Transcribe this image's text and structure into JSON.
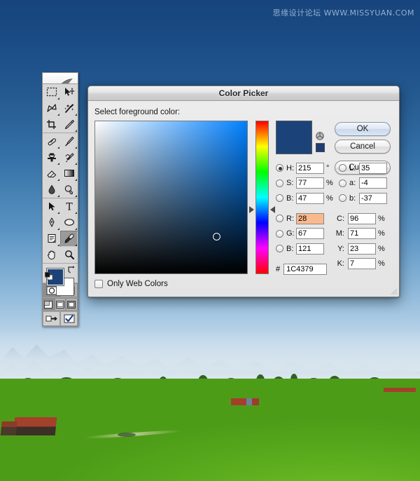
{
  "desktop": {
    "watermark": "思缘设计论坛  WWW.MISSYUAN.COM",
    "wallpaper_name": "alpine-meadow-wallpaper",
    "sky_top_color": "#17447c",
    "sky_horizon_color": "#cfdfeb",
    "meadow_color": "#66b427"
  },
  "toolbar": {
    "name": "Photoshop Tools",
    "logo": "feather-logo",
    "tools": [
      {
        "name": "marquee-tool",
        "icon": "marquee-icon",
        "selected": false
      },
      {
        "name": "move-tool",
        "icon": "move-icon",
        "selected": false
      },
      {
        "name": "lasso-tool",
        "icon": "lasso-icon",
        "selected": false
      },
      {
        "name": "magic-wand-tool",
        "icon": "magic-wand-icon",
        "selected": false
      },
      {
        "name": "crop-tool",
        "icon": "crop-icon",
        "selected": false
      },
      {
        "name": "slice-tool",
        "icon": "slice-icon",
        "selected": false
      },
      {
        "name": "healing-brush-tool",
        "icon": "healing-brush-icon",
        "selected": false
      },
      {
        "name": "brush-tool",
        "icon": "brush-icon",
        "selected": false
      },
      {
        "name": "clone-stamp-tool",
        "icon": "clone-stamp-icon",
        "selected": false
      },
      {
        "name": "history-brush-tool",
        "icon": "history-brush-icon",
        "selected": false
      },
      {
        "name": "eraser-tool",
        "icon": "eraser-icon",
        "selected": false
      },
      {
        "name": "gradient-tool",
        "icon": "gradient-icon",
        "selected": false
      },
      {
        "name": "blur-tool",
        "icon": "blur-droplet-icon",
        "selected": false
      },
      {
        "name": "dodge-tool",
        "icon": "dodge-icon",
        "selected": false
      },
      {
        "name": "path-selection-tool",
        "icon": "path-arrow-icon",
        "selected": false
      },
      {
        "name": "type-tool",
        "icon": "type-t-icon",
        "selected": false
      },
      {
        "name": "pen-tool",
        "icon": "pen-icon",
        "selected": false
      },
      {
        "name": "shape-tool",
        "icon": "ellipse-shape-icon",
        "selected": false
      },
      {
        "name": "notes-tool",
        "icon": "notes-icon",
        "selected": false
      },
      {
        "name": "eyedropper-tool",
        "icon": "eyedropper-icon",
        "selected": true
      },
      {
        "name": "hand-tool",
        "icon": "hand-icon",
        "selected": false
      },
      {
        "name": "zoom-tool",
        "icon": "magnifier-icon",
        "selected": false
      }
    ],
    "foreground_color": "#1C4379",
    "background_color": "#FFFFFF",
    "swap_colors": "swap-colors-icon",
    "default_colors": "default-colors-icon",
    "mask_modes": [
      {
        "name": "standard-mask-mode",
        "icon": "standard-mask-icon",
        "selected": true
      },
      {
        "name": "quick-mask-mode",
        "icon": "quick-mask-icon",
        "selected": false
      }
    ],
    "screen_modes": [
      {
        "name": "standard-screen-mode",
        "icon": "standard-screen-icon",
        "selected": true
      },
      {
        "name": "full-screen-menubar-mode",
        "icon": "full-screen-menubar-icon",
        "selected": false
      },
      {
        "name": "full-screen-mode",
        "icon": "full-screen-icon",
        "selected": false
      }
    ],
    "jump_buttons": [
      {
        "name": "jump-to-imageready",
        "icon": "jump-arrow-icon"
      },
      {
        "name": "imageready-check",
        "icon": "checkmark-icon"
      }
    ]
  },
  "dialog": {
    "title": "Color Picker",
    "select_label": "Select foreground color:",
    "buttons": {
      "ok": "OK",
      "cancel": "Cancel",
      "custom": "Custom"
    },
    "preview": {
      "new_color": "#1C4379",
      "web_safe_chip": "#1f3d73",
      "web_cube_icon": "web-safe-cube-icon"
    },
    "field": {
      "hue_base_color": "#0080ff",
      "marker_x_pct": 77,
      "marker_y_pct": 73
    },
    "hue_slider": {
      "value": 215,
      "position_pct": 57
    },
    "hsb": [
      {
        "key": "H",
        "label": "H:",
        "value": "215",
        "unit": "°",
        "selected": true
      },
      {
        "key": "S",
        "label": "S:",
        "value": "77",
        "unit": "%",
        "selected": false
      },
      {
        "key": "B",
        "label": "B:",
        "value": "47",
        "unit": "%",
        "selected": false
      }
    ],
    "lab": [
      {
        "key": "L",
        "label": "L:",
        "value": "35",
        "unit": "",
        "selected": false
      },
      {
        "key": "a",
        "label": "a:",
        "value": "-4",
        "unit": "",
        "selected": false
      },
      {
        "key": "b",
        "label": "b:",
        "value": "-37",
        "unit": "",
        "selected": false
      }
    ],
    "rgb": [
      {
        "key": "R",
        "label": "R:",
        "value": "28",
        "unit": "",
        "selected": false,
        "highlighted": true
      },
      {
        "key": "G",
        "label": "G:",
        "value": "67",
        "unit": "",
        "selected": false,
        "highlighted": false
      },
      {
        "key": "B",
        "label": "B:",
        "value": "121",
        "unit": "",
        "selected": false,
        "highlighted": false
      }
    ],
    "cmyk": [
      {
        "key": "C",
        "label": "C:",
        "value": "96",
        "unit": "%"
      },
      {
        "key": "M",
        "label": "M:",
        "value": "71",
        "unit": "%"
      },
      {
        "key": "Y",
        "label": "Y:",
        "value": "23",
        "unit": "%"
      },
      {
        "key": "K",
        "label": "K:",
        "value": "7",
        "unit": "%"
      }
    ],
    "hex": {
      "prefix": "#",
      "value": "1C4379"
    },
    "only_web_colors": {
      "label": "Only Web Colors",
      "checked": false
    }
  }
}
